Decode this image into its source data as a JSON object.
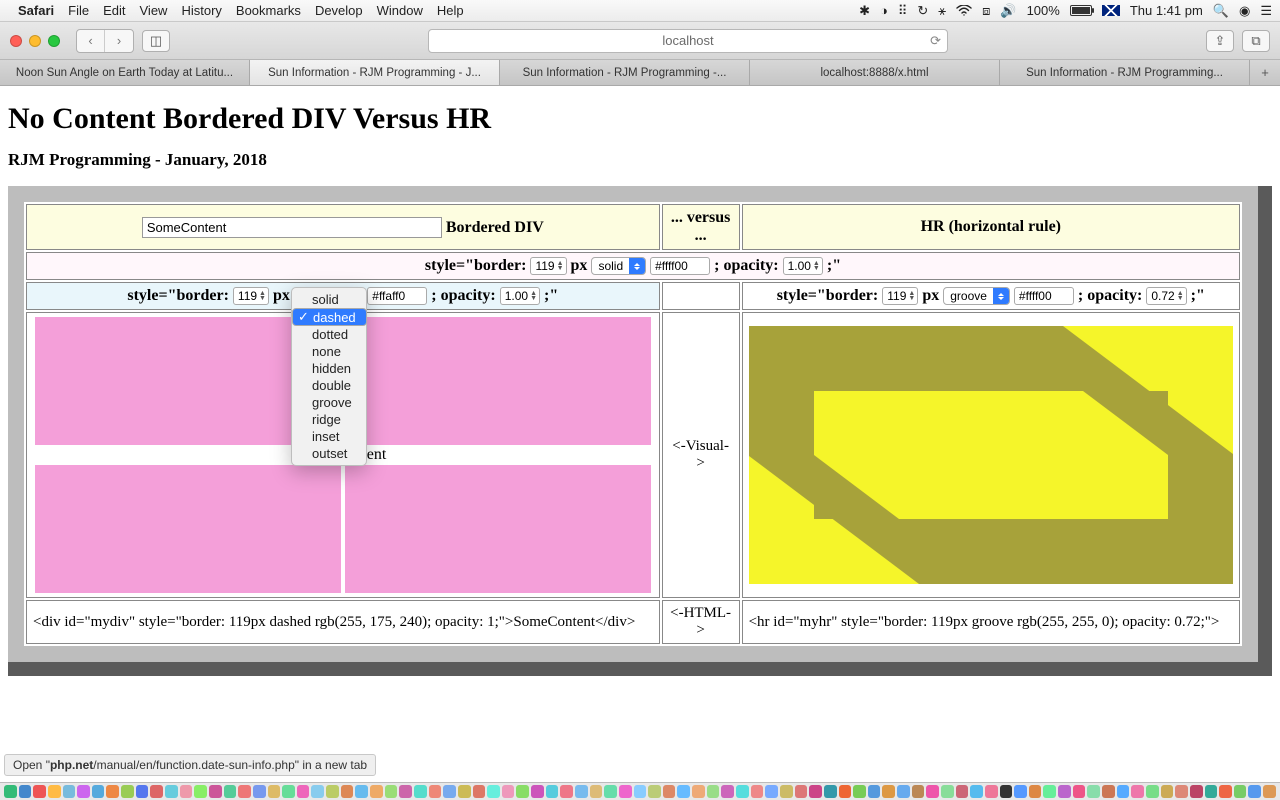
{
  "menubar": {
    "app": "Safari",
    "items": [
      "File",
      "Edit",
      "View",
      "History",
      "Bookmarks",
      "Develop",
      "Window",
      "Help"
    ],
    "battery_pct": "100%",
    "clock": "Thu 1:41 pm"
  },
  "toolbar": {
    "address": "localhost"
  },
  "tabs": [
    "Noon Sun Angle on Earth Today at Latitu...",
    "Sun Information - RJM Programming - J...",
    "Sun Information - RJM Programming -...",
    "localhost:8888/x.html",
    "Sun Information - RJM Programming..."
  ],
  "active_tab": 1,
  "page": {
    "h1": "No Content Bordered DIV Versus HR",
    "h3": "RJM Programming - January, 2018",
    "left_header_input": "SomeContent",
    "left_header_label": " Bordered DIV",
    "mid_header": "... versus ...",
    "right_header": "HR (horizontal rule)",
    "row2": {
      "label_pre": "style=\"border: ",
      "width": "119",
      "unit": "px",
      "style_sel": "solid",
      "color": "#ffff00",
      "op_label": " ; opacity: ",
      "opacity": "1.00",
      "end": " ;\""
    },
    "row3_left": {
      "label_pre": "style=\"border: ",
      "width": "119",
      "unit": "px",
      "style_sel": "dashed",
      "color": "#ffaff0",
      "op_label": " ; opacity: ",
      "opacity": "1.00",
      "end": " ;\""
    },
    "row3_right": {
      "label_pre": "style=\"border: ",
      "width": "119",
      "unit": "px",
      "style_sel": "groove",
      "color": "#ffff00",
      "op_label": " ; opacity: ",
      "opacity": "0.72",
      "end": " ;\""
    },
    "visual_label": "<-Visual->",
    "visual_left_text": "SomeContent",
    "html_label": "<-HTML->",
    "code_left": "<div id=\"mydiv\" style=\"border: 119px dashed rgb(255, 175, 240); opacity: 1;\">SomeContent</div>",
    "code_right": "<hr id=\"myhr\" style=\"border: 119px groove rgb(255, 255, 0); opacity: 0.72;\">"
  },
  "dropdown": {
    "options": [
      "solid",
      "dashed",
      "dotted",
      "none",
      "hidden",
      "double",
      "groove",
      "ridge",
      "inset",
      "outset"
    ],
    "selected": "dashed"
  },
  "status": {
    "pre": "Open \"",
    "bold": "php.net",
    "rest": "/manual/en/function.date-sun-info.php\" in a new tab"
  },
  "dock_colors": [
    "#3b7",
    "#48c",
    "#e55",
    "#fb4",
    "#7bd",
    "#c6e",
    "#5ad",
    "#e84",
    "#9c5",
    "#57e",
    "#d66",
    "#6cd",
    "#e9a",
    "#8e6",
    "#c59",
    "#5c9",
    "#e77",
    "#79e",
    "#db6",
    "#6d9",
    "#e6b",
    "#8ce",
    "#bc6",
    "#d85",
    "#6be",
    "#ea6",
    "#9d7",
    "#c6a",
    "#5dc",
    "#e87",
    "#7ae",
    "#cb5",
    "#d76",
    "#6ed",
    "#e9b",
    "#8d6",
    "#c5b",
    "#5cd",
    "#e78",
    "#7be",
    "#db7",
    "#6da",
    "#e6c",
    "#8cf",
    "#bc7",
    "#d86",
    "#6bf",
    "#ea7",
    "#9d8",
    "#c6b",
    "#5dd",
    "#e88",
    "#7af",
    "#cb6",
    "#d77",
    "#c48",
    "#39a",
    "#e63",
    "#7c5",
    "#59d",
    "#d94",
    "#6ae",
    "#b85",
    "#e5a",
    "#8d9",
    "#c67",
    "#5be",
    "#e79",
    "#333",
    "#59f",
    "#d84",
    "#6e9",
    "#b6c",
    "#e58",
    "#8da",
    "#c75",
    "#5af",
    "#e7a",
    "#7d8",
    "#ca5",
    "#d87",
    "#b46",
    "#3a9",
    "#e64",
    "#7c6",
    "#59e",
    "#d95"
  ]
}
